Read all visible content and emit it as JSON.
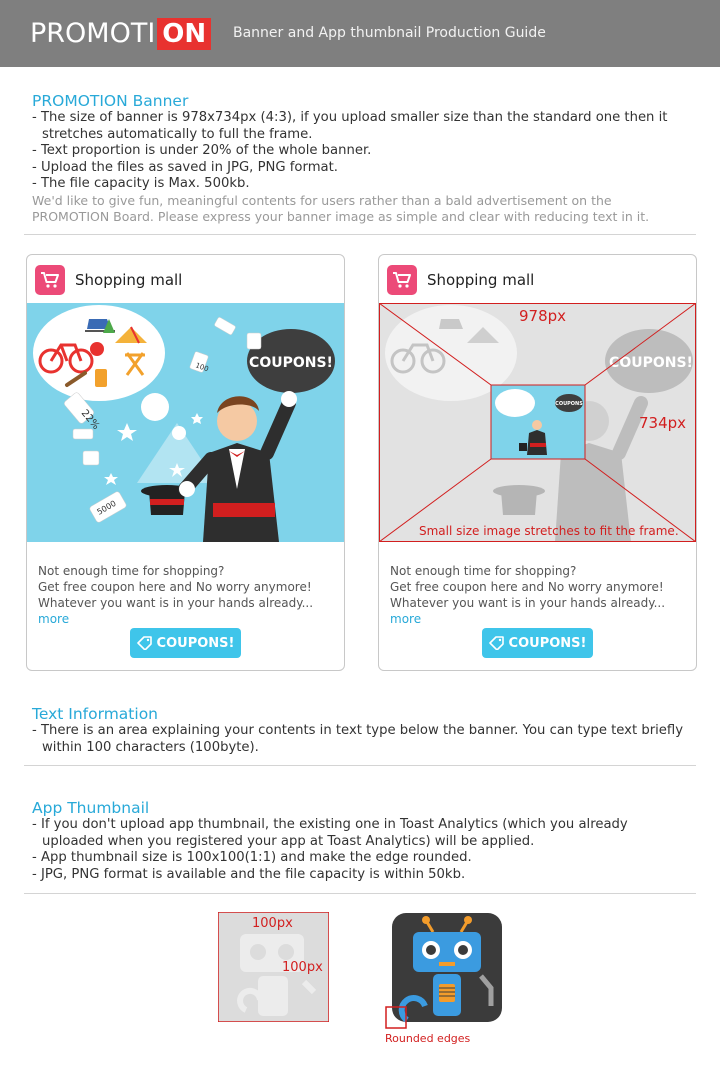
{
  "header": {
    "logo_main": "PROMOTI",
    "logo_box": "ON",
    "subtitle": "Banner and App thumbnail Production Guide"
  },
  "banner_section": {
    "title": "PROMOTION Banner",
    "bullets": [
      "- The size of banner is 978x734px (4:3), if you upload smaller size than the standard one then it stretches automatically to full the frame.",
      "- Text proportion is under 20% of the whole banner.",
      "- Upload the files as saved in JPG, PNG format.",
      "- The file capacity is Max. 500kb."
    ],
    "note": "We'd like to give fun, meaningful contents for users rather than a bald advertisement on the PROMOTION Board. Please express your banner image as simple and clear with reducing text in it."
  },
  "cards": [
    {
      "title": "Shopping mall",
      "line1": "Not enough time for shopping?",
      "line2": "Get free coupon here and No worry anymore!",
      "line3": "Whatever you want is in your hands already...",
      "more": "more",
      "button": "COUPONS!",
      "bubble": "COUPONS!",
      "tag1": "22%",
      "tag2": "5000",
      "tag3": "100"
    },
    {
      "title": "Shopping mall",
      "line1": "Not enough time for shopping?",
      "line2": "Get free coupon here and No worry anymore!",
      "line3": "Whatever you want is in your hands already...",
      "more": "more",
      "button": "COUPONS!",
      "bubble": "COUPONS!",
      "width_label": "978px",
      "height_label": "734px",
      "stretch_note": "Small size image stretches to fit the frame.",
      "mini_bubble": "COUPONS"
    }
  ],
  "text_section": {
    "title": "Text Information",
    "bullets": [
      "- There is an area explaining your contents in text type below the banner. You can type text briefly within 100 characters (100byte)."
    ]
  },
  "thumb_section": {
    "title": "App Thumbnail",
    "bullets": [
      "- If you don't upload app thumbnail, the existing one in Toast Analytics (which you already uploaded when you registered your app at Toast Analytics) will be applied.",
      "- App thumbnail size is 100x100(1:1) and make the edge rounded.",
      "- JPG, PNG format is available and the file capacity is within 50kb."
    ],
    "w_label": "100px",
    "h_label": "100px",
    "rounded_label": "Rounded edges"
  },
  "colors": {
    "accent": "#28a9d8",
    "logo_red": "#e8322f",
    "header_gray": "#7f7f7f",
    "cart_pink": "#ec4a78",
    "button_blue": "#3fc5ea",
    "annotation_red": "#d21f1f"
  }
}
